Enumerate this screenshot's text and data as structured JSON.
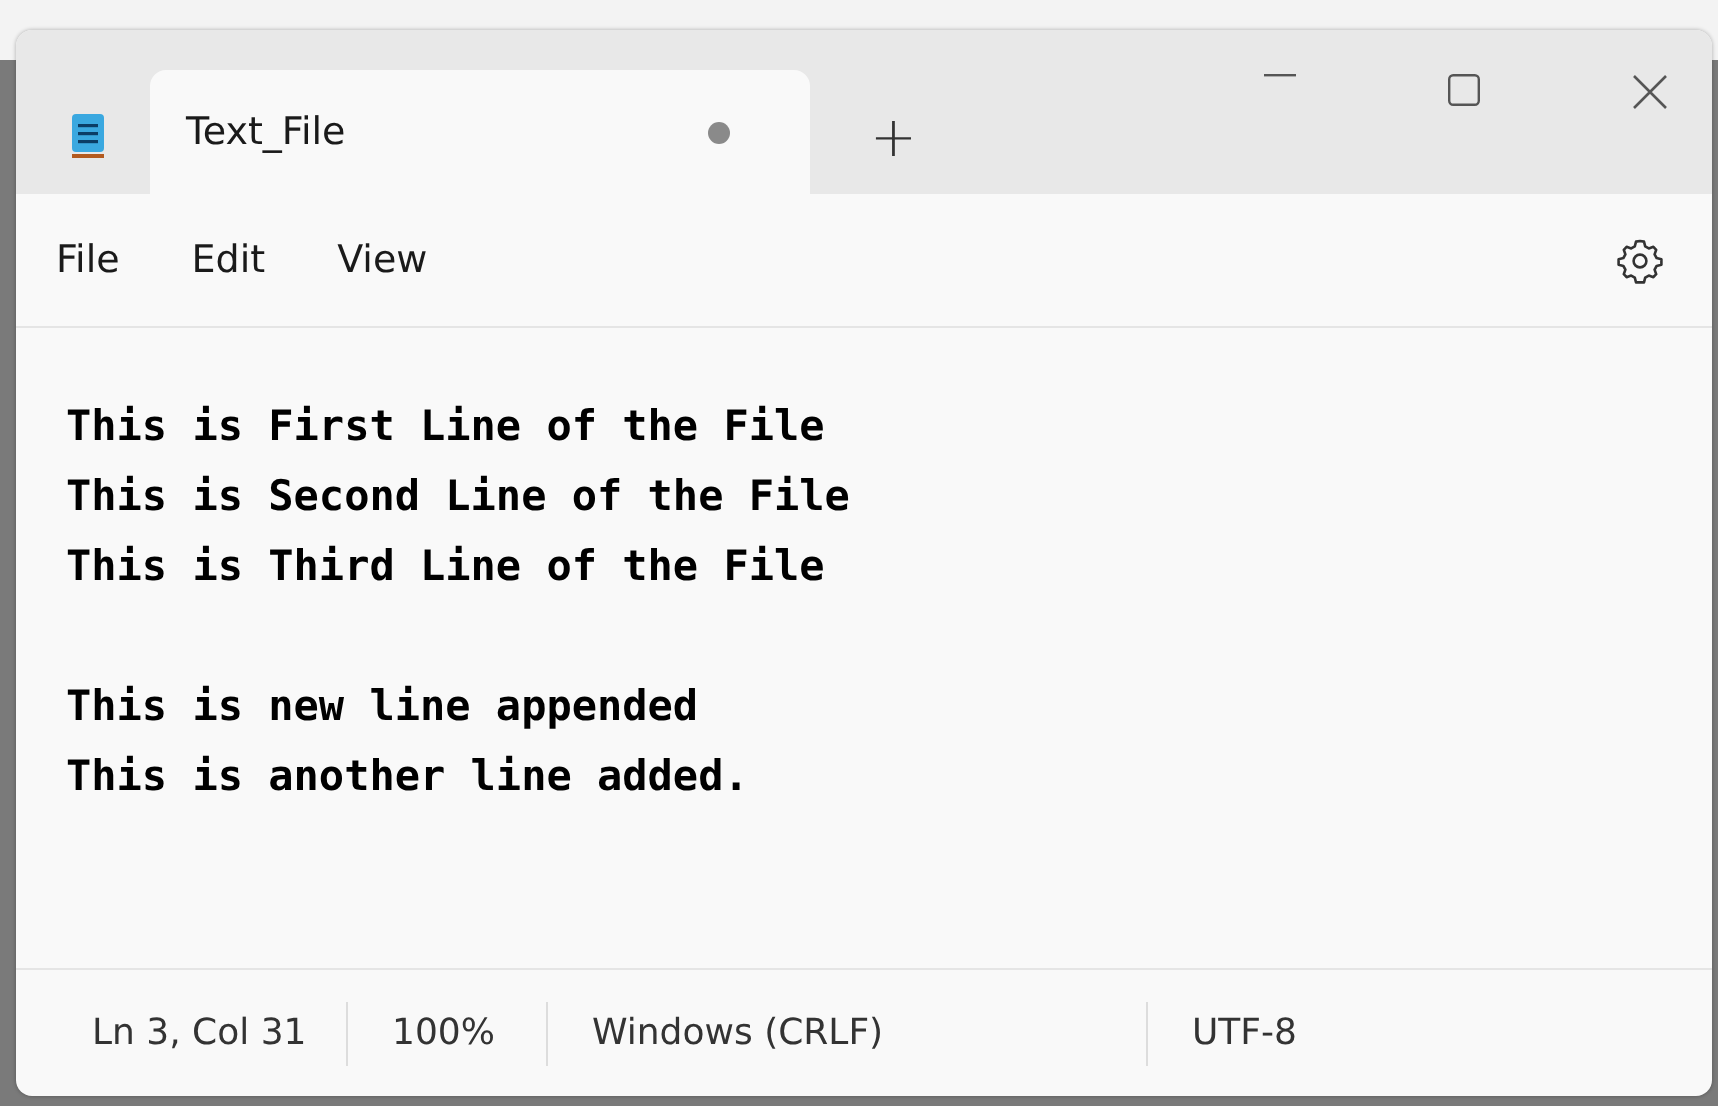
{
  "tabs": [
    {
      "label": "Text_File",
      "selected": true,
      "unsaved": true
    }
  ],
  "new_tab": "+",
  "menu": [
    "File",
    "Edit",
    "View"
  ],
  "paragraphs": [
    {
      "lines": [
        "This is First Line of the File",
        "This is Second Line of the File",
        "This is Third Line of the File"
      ]
    },
    {
      "lines": [
        "This is new line appended",
        "This is another line added."
      ]
    }
  ],
  "status_bar": [
    "Ln 3, Col 31",
    "100%",
    "Windows (CRLF)",
    "UTF-8"
  ]
}
